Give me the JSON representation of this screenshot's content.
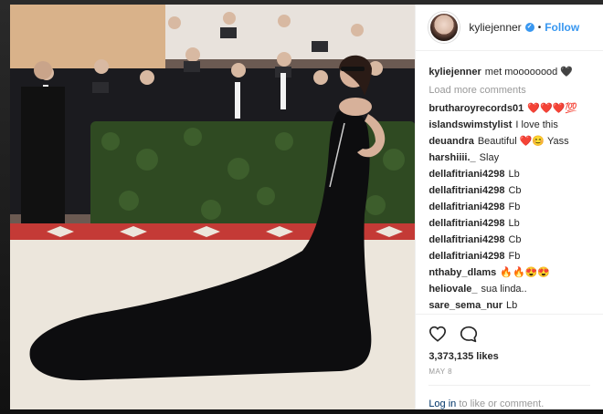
{
  "header": {
    "username": "kyliejenner",
    "follow_label": "Follow",
    "dot": "•"
  },
  "caption": {
    "user": "kyliejenner",
    "text": "met moooooood 🖤"
  },
  "load_more": "Load more comments",
  "comments": [
    {
      "user": "brutharoyrecords01",
      "text": "❤️❤️❤️💯"
    },
    {
      "user": "islandswimstylist",
      "text": "I love this"
    },
    {
      "user": "deuandra",
      "text": "Beautiful ❤️😊 Yass"
    },
    {
      "user": "harshiiii._",
      "text": "Slay"
    },
    {
      "user": "dellafitriani4298",
      "text": "Lb"
    },
    {
      "user": "dellafitriani4298",
      "text": "Cb"
    },
    {
      "user": "dellafitriani4298",
      "text": "Fb"
    },
    {
      "user": "dellafitriani4298",
      "text": "Lb"
    },
    {
      "user": "dellafitriani4298",
      "text": "Cb"
    },
    {
      "user": "dellafitriani4298",
      "text": "Fb"
    },
    {
      "user": "nthaby_dlams",
      "text": "🔥🔥😍😍"
    },
    {
      "user": "heliovale_",
      "text": "sua linda.."
    },
    {
      "user": "sare_sema_nur",
      "text": "Lb"
    }
  ],
  "likes": "3,373,135 likes",
  "date": "MAY 8",
  "login": {
    "link": "Log in",
    "rest": " to like or comment."
  },
  "colors": {
    "accent": "#3897f0",
    "text": "#262626",
    "muted": "#999999"
  },
  "icons": {
    "like": "heart-outline-icon",
    "comment": "speech-bubble-icon",
    "verified": "verified-badge-icon"
  }
}
